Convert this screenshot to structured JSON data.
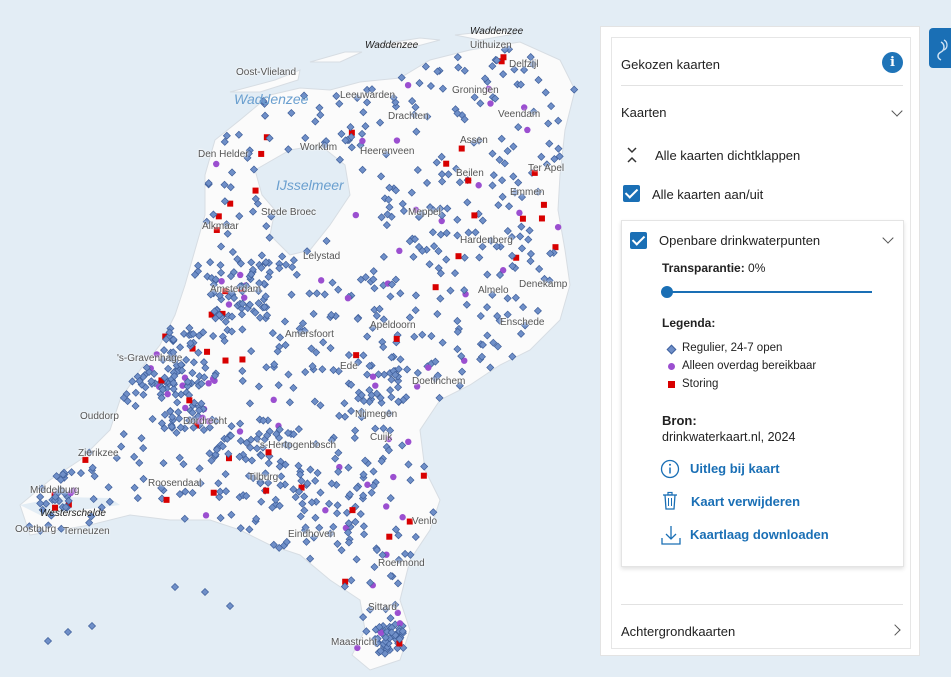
{
  "map": {
    "labels": {
      "waddenzee_large": "Waddenzee",
      "waddenzee_small_1": "Waddenzee",
      "waddenzee_small_2": "Waddenzee",
      "ijsselmeer": "IJsselmeer",
      "westerschelde": "Westerschelde",
      "uithuizen": "Uithuizen",
      "delfzijl": "Delfzijl",
      "oost_vlieland": "Oost-Vlieland",
      "leeuwarden": "Leeuwarden",
      "groningen": "Groningen",
      "veendam": "Veendam",
      "drachten": "Drachten",
      "assen": "Assen",
      "ter_apel": "Ter Apel",
      "den_helder": "Den Helder",
      "workum": "Workum",
      "heerenveen": "Heerenveen",
      "beilen": "Beilen",
      "emmen": "Emmen",
      "stede_broec": "Stede Broec",
      "meppel": "Meppel",
      "alkmaar": "Alkmaar",
      "hardenberg": "Hardenberg",
      "lelystad": "Lelystad",
      "amsterdam": "Amsterdam",
      "almelo": "Almelo",
      "denekamp": "Denekamp",
      "enschede": "Enschede",
      "amersfoort": "Amersfoort",
      "apeldoorn": "Apeldoorn",
      "den_haag": "'s-Gravenhage",
      "doetinchem": "Doetinchem",
      "ede": "Ede",
      "ouddorp": "Ouddorp",
      "dordrecht": "Dordrecht",
      "nijmegen": "Nijmegen",
      "zierikzee": "Zierikzee",
      "cuijk": "Cuijk",
      "den_bosch": "'s-Hertogenbosch",
      "roosendaal": "Roosendaal",
      "tilburg": "Tilburg",
      "middelburg": "Middelburg",
      "oostburg": "Oostburg",
      "terneuzen": "Terneuzen",
      "venlo": "Venlo",
      "eindhoven": "Eindhoven",
      "roermond": "Roermond",
      "sittard": "Sittard",
      "maastricht": "Maastricht"
    }
  },
  "panel": {
    "title": "Gekozen kaarten",
    "section_kaarten": "Kaarten",
    "collapse_all": "Alle kaarten dichtklappen",
    "toggle_all": "Alle kaarten aan/uit",
    "layer": {
      "name": "Openbare drinkwaterpunten",
      "transparency_label": "Transparantie:",
      "transparency_value": "0%",
      "transparency_fraction": 0.0,
      "legend_title": "Legenda:",
      "legend": [
        {
          "label": "Regulier, 24-7 open",
          "symbol": "diamond",
          "color": "#6f8fc8"
        },
        {
          "label": "Alleen overdag bereikbaar",
          "symbol": "circle",
          "color": "#9b4fd0"
        },
        {
          "label": "Storing",
          "symbol": "square",
          "color": "#d80000"
        }
      ],
      "source_title": "Bron:",
      "source_value": "drinkwaterkaart.nl, 2024",
      "action_explain": "Uitleg bij kaart",
      "action_remove": "Kaart verwijderen",
      "action_download": "Kaartlaag downloaden"
    },
    "section_background": "Achtergrondkaarten"
  },
  "colors": {
    "accent": "#1a6fb5",
    "sea": "#e3edf5",
    "land": "#fbfbfb",
    "regular_point": "#6f8fc8",
    "daytime_point": "#9b4fd0",
    "fault_point": "#d80000"
  },
  "icons": [
    "info-icon",
    "chevron-down-icon",
    "chevron-right-icon",
    "collapse-icon",
    "checkbox-icon",
    "info-circle-icon",
    "trash-icon",
    "download-icon",
    "layers-icon"
  ]
}
